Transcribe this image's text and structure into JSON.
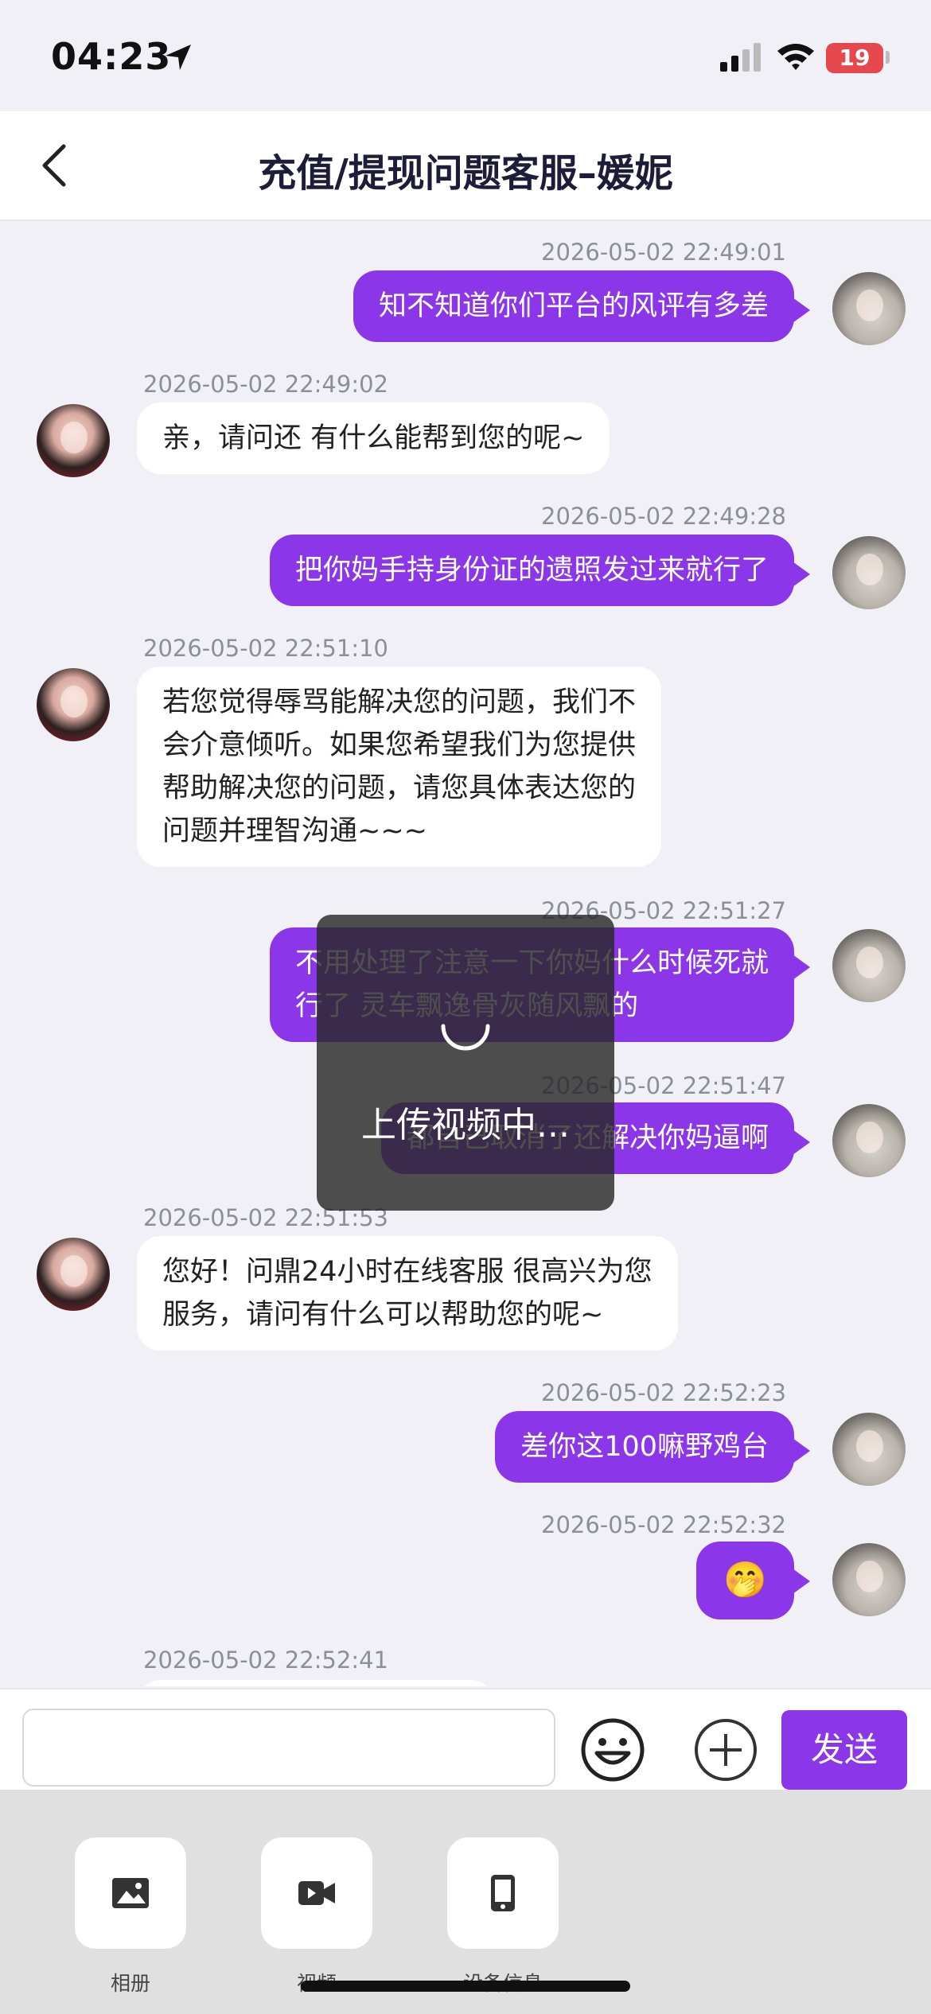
{
  "status_bar": {
    "time": "04:23",
    "battery": "19"
  },
  "header": {
    "title": "充值/提现问题客服–媛妮"
  },
  "messages": [
    {
      "side": "out",
      "timestamp": "2026-05-02 22:49:01",
      "lines": [
        "知不知道你们平台的风评有多差"
      ]
    },
    {
      "side": "in",
      "timestamp": "2026-05-02 22:49:02",
      "lines": [
        "亲，请问还  有什么能帮到您的呢~"
      ]
    },
    {
      "side": "out",
      "timestamp": "2026-05-02 22:49:28",
      "lines": [
        "把你妈手持身份证的遗照发过来就行了"
      ]
    },
    {
      "side": "in",
      "timestamp": "2026-05-02 22:51:10",
      "lines": [
        "若您觉得辱骂能解决您的问题，我们不",
        "会介意倾听。如果您希望我们为您提供",
        "帮助解决您的问题，请您具体表达您的",
        "问题并理智沟通~~~"
      ]
    },
    {
      "side": "out",
      "timestamp": "2026-05-02 22:51:27",
      "lines": [
        "不用处理了注意一下你妈什么时候死就",
        "行了 灵车飘逸骨灰随风飘的"
      ]
    },
    {
      "side": "out",
      "timestamp": "2026-05-02 22:51:47",
      "lines": [
        "都自己取消了还解决你妈逼啊"
      ]
    },
    {
      "side": "in",
      "timestamp": "2026-05-02 22:51:53",
      "lines": [
        "您好！问鼎24小时在线客服 很高兴为您",
        "服务，请问有什么可以帮助您的呢~"
      ]
    },
    {
      "side": "out",
      "timestamp": "2026-05-02 22:52:23",
      "lines": [
        "差你这100嘛野鸡台"
      ]
    },
    {
      "side": "out",
      "timestamp": "2026-05-02 22:52:32",
      "lines": [
        "🤭"
      ]
    },
    {
      "side": "in",
      "timestamp": "2026-05-02 22:52:41",
      "lines": []
    }
  ],
  "toast": {
    "text": "上传视频中..."
  },
  "input": {
    "placeholder": "",
    "send_label": "发送"
  },
  "tools": [
    {
      "label": "相册",
      "icon": "image-icon"
    },
    {
      "label": "视频",
      "icon": "video-icon"
    },
    {
      "label": "设备信息",
      "icon": "device-icon"
    }
  ],
  "colors": {
    "accent": "#8b36e8",
    "background": "#f0f0f6"
  }
}
